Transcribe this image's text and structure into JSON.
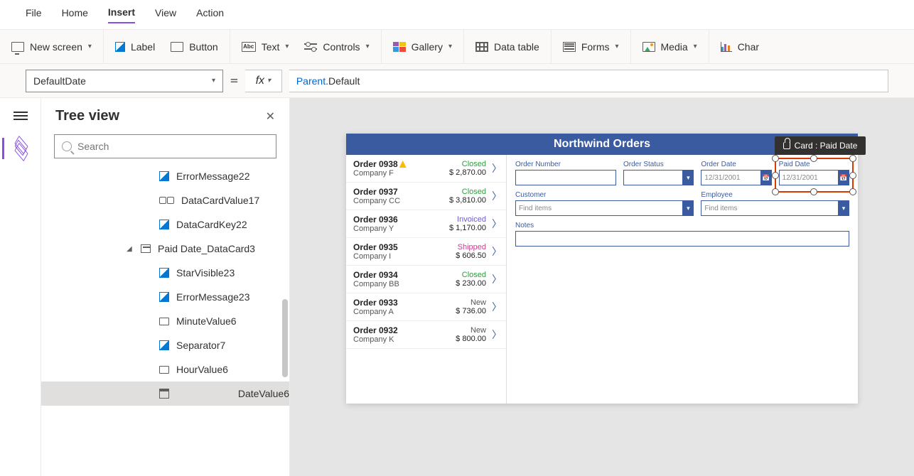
{
  "top_tabs": {
    "file": "File",
    "home": "Home",
    "insert": "Insert",
    "view": "View",
    "action": "Action"
  },
  "ribbon": {
    "new_screen": "New screen",
    "label": "Label",
    "button": "Button",
    "text": "Text",
    "controls": "Controls",
    "gallery": "Gallery",
    "data_table": "Data table",
    "forms": "Forms",
    "media": "Media",
    "chart": "Char",
    "abc": "Abc"
  },
  "formula": {
    "property": "DefaultDate",
    "fx": "fx",
    "equals": "=",
    "expression_tok1": "Parent",
    "expression_dot": ".",
    "expression_tok2": "Default"
  },
  "tree": {
    "title": "Tree view",
    "search_placeholder": "Search",
    "items": [
      {
        "label": "ErrorMessage22",
        "icon": "edit"
      },
      {
        "label": "DataCardValue17",
        "icon": "link"
      },
      {
        "label": "DataCardKey22",
        "icon": "edit"
      },
      {
        "label": "Paid Date_DataCard3",
        "icon": "card",
        "parent": true
      },
      {
        "label": "StarVisible23",
        "icon": "edit"
      },
      {
        "label": "ErrorMessage23",
        "icon": "edit"
      },
      {
        "label": "MinuteValue6",
        "icon": "box"
      },
      {
        "label": "Separator7",
        "icon": "edit"
      },
      {
        "label": "HourValue6",
        "icon": "box"
      },
      {
        "label": "DateValue6",
        "icon": "cal",
        "selected": true
      }
    ]
  },
  "app": {
    "title": "Northwind Orders",
    "orders": [
      {
        "id": "Order 0938",
        "company": "Company F",
        "status": "Closed",
        "status_class": "st-closed",
        "amount": "$ 2,870.00",
        "warn": true
      },
      {
        "id": "Order 0937",
        "company": "Company CC",
        "status": "Closed",
        "status_class": "st-closed",
        "amount": "$ 3,810.00"
      },
      {
        "id": "Order 0936",
        "company": "Company Y",
        "status": "Invoiced",
        "status_class": "st-invoiced",
        "amount": "$ 1,170.00"
      },
      {
        "id": "Order 0935",
        "company": "Company I",
        "status": "Shipped",
        "status_class": "st-shipped",
        "amount": "$ 606.50"
      },
      {
        "id": "Order 0934",
        "company": "Company BB",
        "status": "Closed",
        "status_class": "st-closed",
        "amount": "$ 230.00"
      },
      {
        "id": "Order 0933",
        "company": "Company A",
        "status": "New",
        "status_class": "st-new",
        "amount": "$ 736.00"
      },
      {
        "id": "Order 0932",
        "company": "Company K",
        "status": "New",
        "status_class": "st-new",
        "amount": "$ 800.00"
      }
    ],
    "form": {
      "order_number": "Order Number",
      "order_status": "Order Status",
      "order_date": "Order Date",
      "order_date_val": "12/31/2001",
      "paid_date": "Paid Date",
      "paid_date_val": "12/31/2001",
      "customer": "Customer",
      "employee": "Employee",
      "find_items": "Find items",
      "notes": "Notes"
    }
  },
  "tooltip": "Card : Paid Date"
}
